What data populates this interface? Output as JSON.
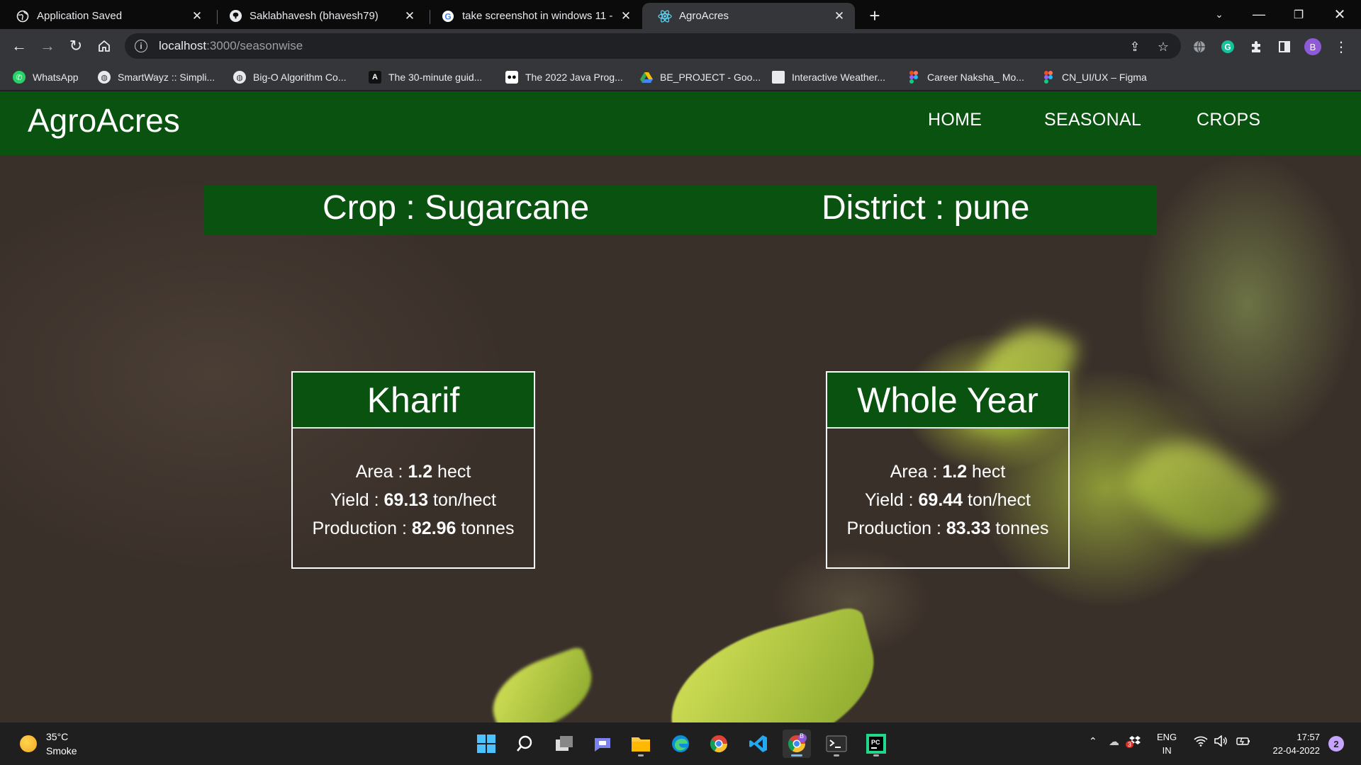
{
  "browser": {
    "tabs": [
      {
        "title": "Application Saved",
        "icon": "globe-icon"
      },
      {
        "title": "Saklabhavesh (bhavesh79)",
        "icon": "github-icon"
      },
      {
        "title": "take screenshot in windows 11 -",
        "icon": "google-icon"
      },
      {
        "title": "AgroAcres",
        "icon": "react-icon"
      }
    ],
    "url_host": "localhost",
    "url_path": ":3000/seasonwise",
    "profile_initial": "B",
    "bookmarks": [
      {
        "label": "WhatsApp",
        "icon": "whatsapp-icon"
      },
      {
        "label": "SmartWayz :: Simpli...",
        "icon": "globe-icon"
      },
      {
        "label": "Big-O Algorithm Co...",
        "icon": "globe-icon"
      },
      {
        "label": "The 30-minute guid...",
        "icon": "angular-icon"
      },
      {
        "label": "The 2022 Java Prog...",
        "icon": "medium-icon"
      },
      {
        "label": "BE_PROJECT - Goo...",
        "icon": "drive-icon"
      },
      {
        "label": "Interactive Weather...",
        "icon": "page-icon"
      },
      {
        "label": "Career Naksha_ Mo...",
        "icon": "figma-icon"
      },
      {
        "label": "CN_UI/UX – Figma",
        "icon": "figma-icon"
      }
    ]
  },
  "app": {
    "brand": "AgroAcres",
    "nav": [
      "HOME",
      "SEASONAL",
      "CROPS"
    ],
    "crop_label": "Crop : Sugarcane",
    "district_label": "District : pune",
    "cards": [
      {
        "season": "Kharif",
        "area_label": "Area : ",
        "area_value": "1.2",
        "area_unit": " hect",
        "yield_label": "Yield : ",
        "yield_value": "69.13",
        "yield_unit": " ton/hect",
        "production_label": "Production : ",
        "production_value": "82.96",
        "production_unit": " tonnes"
      },
      {
        "season": "Whole Year",
        "area_label": "Area : ",
        "area_value": "1.2",
        "area_unit": " hect",
        "yield_label": "Yield : ",
        "yield_value": "69.44",
        "yield_unit": " ton/hect",
        "production_label": "Production : ",
        "production_value": "83.33",
        "production_unit": " tonnes"
      }
    ],
    "colors": {
      "header_green": "#0a5210"
    }
  },
  "taskbar": {
    "weather_temp": "35°C",
    "weather_desc": "Smoke",
    "lang_top": "ENG",
    "lang_bottom": "IN",
    "time": "17:57",
    "date": "22-04-2022",
    "notification_count": "2",
    "chrome_badge": "B",
    "tray_badge": "3"
  }
}
